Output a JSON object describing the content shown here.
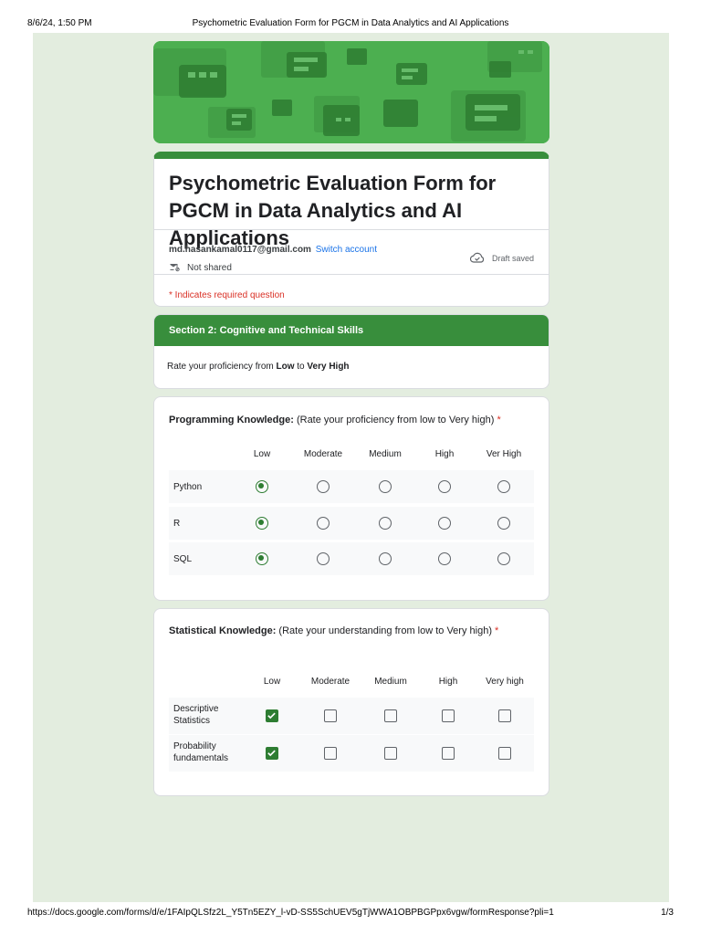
{
  "print": {
    "datetime": "8/6/24, 1:50 PM",
    "title": "Psychometric Evaluation Form for PGCM in Data Analytics and AI Applications",
    "url": "https://docs.google.com/forms/d/e/1FAIpQLSfz2L_Y5Tn5EZY_l-vD-SS5SchUEV5gTjWWA1OBPBGPpx6vgw/formResponse?pli=1",
    "page": "1/3"
  },
  "form": {
    "title": "Psychometric Evaluation Form for PGCM in Data Analytics and AI Applications",
    "email": "md.hasankamal0117@gmail.com",
    "switch_account": "Switch account",
    "not_shared": "Not shared",
    "draft_status": "Draft saved",
    "required_note": "* Indicates required question"
  },
  "section": {
    "title": "Section 2: Cognitive and Technical Skills",
    "desc_prefix": "Rate your proficiency from ",
    "desc_low": "Low",
    "desc_mid": " to ",
    "desc_high": "Very High"
  },
  "q1": {
    "title_bold": "Programming Knowledge:",
    "title_rest": " (Rate your proficiency from low to Very high)",
    "required": "*",
    "columns": [
      "Low",
      "Moderate",
      "Medium",
      "High",
      "Ver High"
    ],
    "rows": [
      {
        "label": "Python",
        "selected": 0
      },
      {
        "label": "R",
        "selected": 0
      },
      {
        "label": "SQL",
        "selected": 0
      }
    ]
  },
  "q2": {
    "title_bold": "Statistical Knowledge:",
    "title_rest": " (Rate your understanding from low to Very high)",
    "required": "*",
    "columns": [
      "Low",
      "Moderate",
      "Medium",
      "High",
      "Very high"
    ],
    "rows": [
      {
        "label": "Descriptive Statistics",
        "checked": [
          0
        ]
      },
      {
        "label": "Probability fundamentals",
        "checked": [
          0
        ]
      }
    ]
  },
  "colors": {
    "accent": "#388e3c",
    "selected": "#2e7d32",
    "required": "#d93025",
    "link": "#1a73e8"
  }
}
